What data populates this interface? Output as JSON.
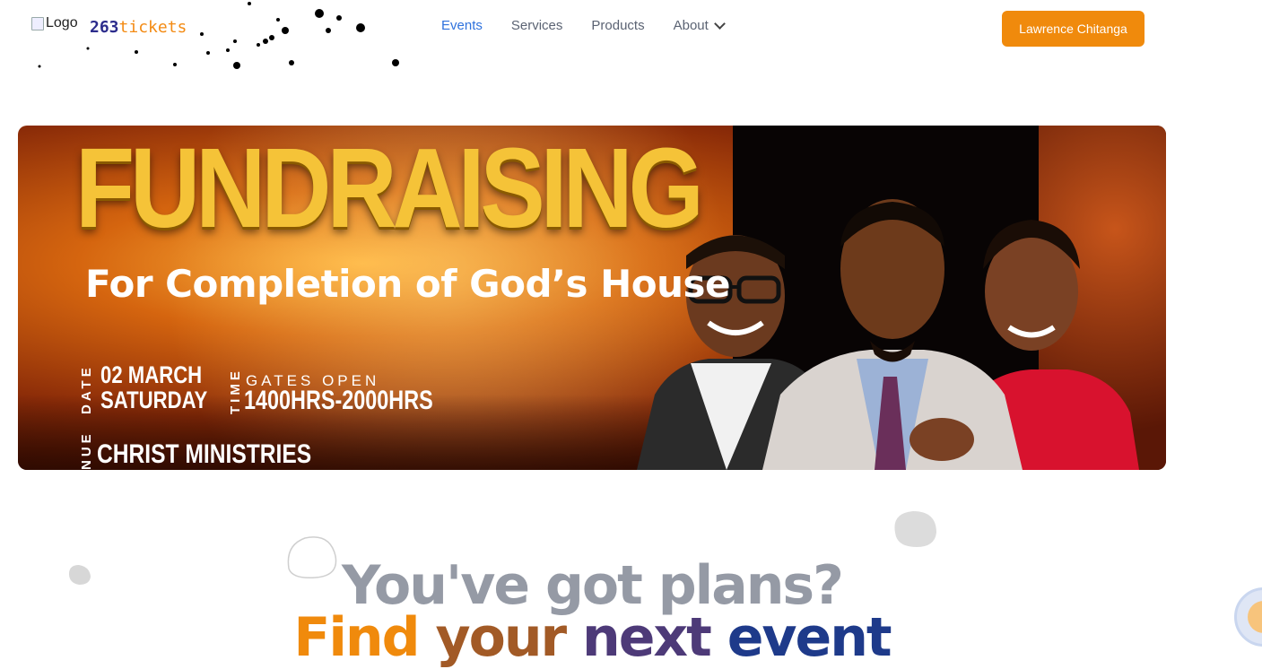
{
  "header": {
    "logo_alt": "Logo",
    "brand_part1": "263",
    "brand_part2": "tickets"
  },
  "nav": {
    "items": [
      {
        "label": "Events",
        "active": true
      },
      {
        "label": "Services",
        "active": false
      },
      {
        "label": "Products",
        "active": false
      },
      {
        "label": "About",
        "active": false,
        "has_dropdown": true
      }
    ]
  },
  "user_button": {
    "label": "Lawrence Chitanga"
  },
  "banner": {
    "headline": "FUNDRAISING",
    "subtitle": "For Completion of God’s House",
    "date_label": "DATE",
    "date_line1": "02 MARCH",
    "date_line2": "SATURDAY",
    "time_label": "TIME",
    "gates": "GATES OPEN",
    "hours": "1400HRS-2000HRS",
    "venue_label": "NUE",
    "venue": "CHRIST MINISTRIES"
  },
  "hero": {
    "line1": "You've got plans?",
    "line2_w1": "Find",
    "line2_w2": "your",
    "line2_w3": "next",
    "line2_w4": "event"
  },
  "colors": {
    "accent": "#f08a0c",
    "nav_active": "#2f72dd",
    "nav_text": "#5b6373",
    "hero_gray": "#959aa5"
  }
}
